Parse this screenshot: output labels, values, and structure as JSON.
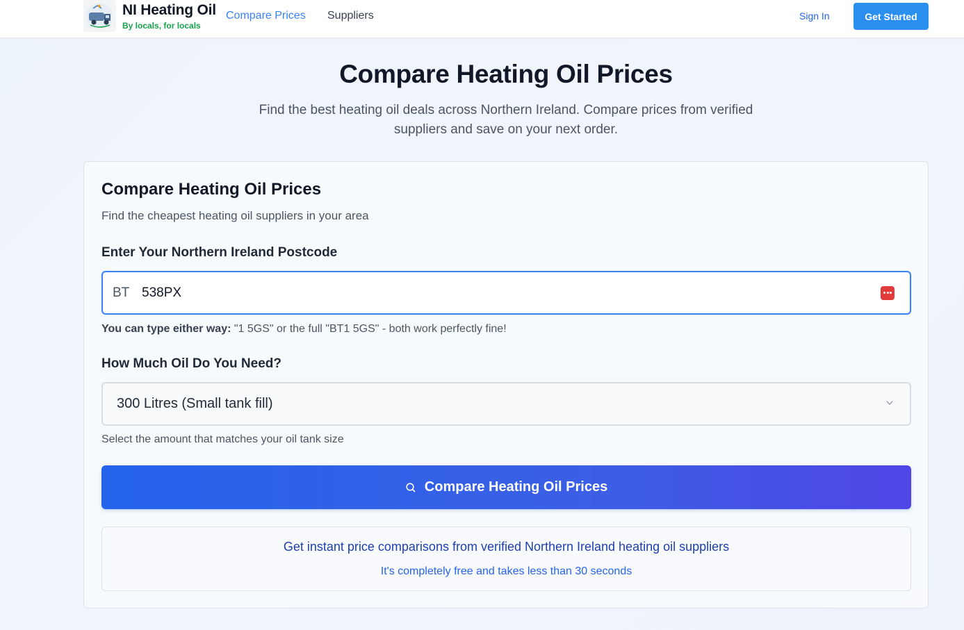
{
  "header": {
    "brand_name": "NI Heating Oil",
    "brand_tagline": "By locals, for locals",
    "nav": {
      "compare_prices": "Compare Prices",
      "suppliers": "Suppliers"
    },
    "sign_in": "Sign In",
    "get_started": "Get Started"
  },
  "hero": {
    "title": "Compare Heating Oil Prices",
    "subtitle": "Find the best heating oil deals across Northern Ireland. Compare prices from verified suppliers and save on your next order."
  },
  "form": {
    "title": "Compare Heating Oil Prices",
    "subtitle": "Find the cheapest heating oil suppliers in your area",
    "postcode": {
      "label": "Enter Your Northern Ireland Postcode",
      "prefix": "BT",
      "value": "538PX",
      "hint_bold": "You can type either way:",
      "hint_text": " \"1 5GS\" or the full \"BT1 5GS\" - both work perfectly fine!"
    },
    "oil": {
      "label": "How Much Oil Do You Need?",
      "selected": "300 Litres (Small tank fill)",
      "help": "Select the amount that matches your oil tank size"
    },
    "submit_label": "Compare Heating Oil Prices",
    "info": {
      "main": "Get instant price comparisons from verified Northern Ireland heating oil suppliers",
      "sub": "It's completely free and takes less than 30 seconds"
    }
  },
  "colors": {
    "accent": "#2563eb",
    "brand_green": "#16a34a",
    "button_gradient_end": "#4f46e5"
  }
}
